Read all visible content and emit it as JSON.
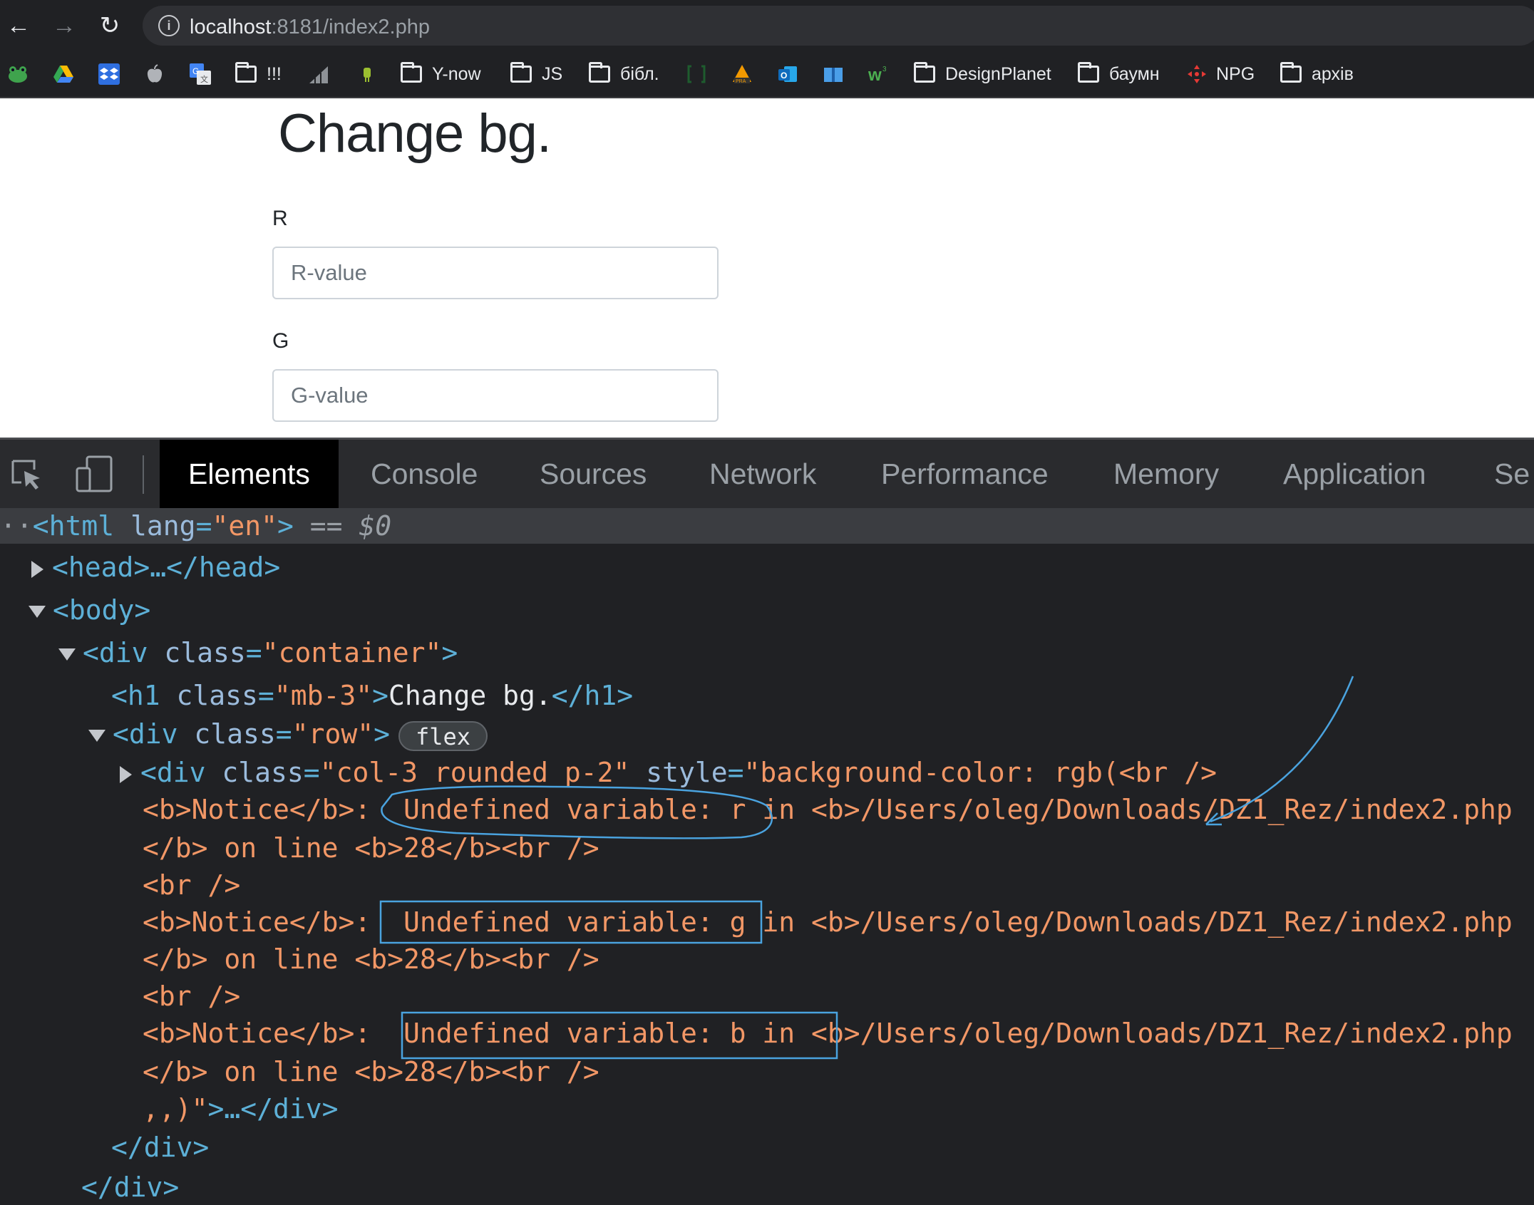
{
  "browser": {
    "url_host": "localhost",
    "url_rest": ":8181/index2.php",
    "bookmarks": [
      {
        "label": "!!!",
        "icon": "folder-icon"
      },
      {
        "label": "Y-now",
        "icon": "folder-icon"
      },
      {
        "label": "JS",
        "icon": "folder-icon"
      },
      {
        "label": "бібл.",
        "icon": "folder-icon"
      },
      {
        "label": "DesignPlanet",
        "icon": "folder-icon"
      },
      {
        "label": "баумн",
        "icon": "folder-icon"
      },
      {
        "label": "NPG",
        "icon": "npg-icon"
      },
      {
        "label": "архів",
        "icon": "folder-icon"
      }
    ]
  },
  "page": {
    "title": "Change bg.",
    "fields": [
      {
        "label": "R",
        "placeholder": "R-value"
      },
      {
        "label": "G",
        "placeholder": "G-value"
      }
    ]
  },
  "devtools": {
    "tabs": [
      "Elements",
      "Console",
      "Sources",
      "Network",
      "Performance",
      "Memory",
      "Application",
      "Se"
    ],
    "active_tab": "Elements",
    "dom": {
      "html_open": "<html",
      "html_attr": "lang",
      "html_val": "\"en\"",
      "html_close": ">",
      "selected_marker": "== $0",
      "head": "<head>…</head>",
      "body": "<body>",
      "div_open": "<div",
      "class_attr": "class",
      "container_val": "\"container\"",
      "tag_end": ">",
      "h1_open": "<h1",
      "h1_class_val": "\"mb-3\"",
      "h1_text": "Change bg.",
      "h1_close": "</h1>",
      "row_val": "\"row\"",
      "flex_badge": "flex",
      "col_val": "\"col-3 rounded p-2\"",
      "style_attr": "style",
      "style_start": "\"background-color: rgb(<br />",
      "notice_tag": "<b>Notice</b>:",
      "notice_r": "  Undefined variable: r in <b>/Users/oleg/Downloads/DZ1_Rez/index2.php",
      "notice_g": "  Undefined variable: g in <b>/Users/oleg/Downloads/DZ1_Rez/index2.php",
      "notice_b": "  Undefined variable: b in <b>/Users/oleg/Downloads/DZ1_Rez/index2.php",
      "line_info": "</b> on line <b>28</b><br />",
      "br": "<br />",
      "style_end": ",,)\"",
      "col_tail": ">…</div>",
      "div_close": "</div>"
    }
  },
  "colors": {
    "tag": "#5db0d7",
    "attr_name": "#9bbbdc",
    "attr_value": "#f29766",
    "annotation": "#4aa3df"
  }
}
